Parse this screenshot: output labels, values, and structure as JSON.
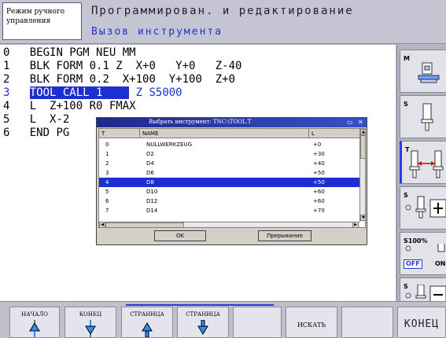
{
  "header": {
    "mode_line1": "Режим ручного",
    "mode_line2": "управления",
    "title": "Программирован. и редактирование",
    "subtitle": "Вызов инструмента"
  },
  "program": {
    "lines": [
      {
        "num": "0",
        "text": "BEGIN PGM NEU MM"
      },
      {
        "num": "1",
        "text": "BLK FORM 0.1 Z  X+0   Y+0   Z-40"
      },
      {
        "num": "2",
        "text": "BLK FORM 0.2  X+100  Y+100  Z+0"
      },
      {
        "num": "3",
        "text_hl": "TOOL CALL 1",
        "text_rest": " Z S5000"
      },
      {
        "num": "4",
        "text": "L  Z+100 R0 FMAX"
      },
      {
        "num": "5",
        "text": "L  X-2"
      },
      {
        "num": "6",
        "text": "END PG"
      }
    ]
  },
  "dialog": {
    "title": "Выбрать инструмент: TNC:\\TOOL.T",
    "columns": [
      "T",
      "NAME",
      "L"
    ],
    "rows": [
      {
        "t": "0",
        "name": "NULLWERKZEUG",
        "l": "+0"
      },
      {
        "t": "1",
        "name": "D2",
        "l": "+30"
      },
      {
        "t": "2",
        "name": "D4",
        "l": "+40"
      },
      {
        "t": "3",
        "name": "D6",
        "l": "+50"
      },
      {
        "t": "4",
        "name": "D8",
        "l": "+50"
      },
      {
        "t": "5",
        "name": "D10",
        "l": "+60"
      },
      {
        "t": "6",
        "name": "D12",
        "l": "+60"
      },
      {
        "t": "7",
        "name": "D14",
        "l": "+70"
      }
    ],
    "selected_index": 4,
    "ok_label": "OK",
    "cancel_label": "Прерывание"
  },
  "right_keys": [
    {
      "label": "M",
      "icon": "machine-table-icon"
    },
    {
      "label": "S",
      "icon": "spindle-icon"
    },
    {
      "label": "T",
      "icon": "tool-length-icon"
    },
    {
      "label": "S",
      "icon": "spindle-plus-icon"
    },
    {
      "label": "S100%",
      "icon": "spindle-override-icon",
      "state": "OFF",
      "state2": "ON"
    },
    {
      "label": "S",
      "icon": "spindle-minus-icon"
    }
  ],
  "softkeys": [
    {
      "label": "НАЧАЛО",
      "icon": "arrow-up-icon"
    },
    {
      "label": "КОНЕЦ",
      "icon": "arrow-down-icon"
    },
    {
      "label": "СТРАНИЦА",
      "icon": "arrow-up-icon"
    },
    {
      "label": "СТРАНИЦА",
      "icon": "arrow-down-icon"
    },
    {
      "label": "",
      "icon": ""
    },
    {
      "label": "ИСКАТЬ",
      "icon": ""
    },
    {
      "label": "",
      "icon": ""
    },
    {
      "label": "КОНЕЦ",
      "icon": ""
    }
  ],
  "colors": {
    "highlight": "#1c2fd0",
    "header_bg": "#c4c4d2",
    "dialog_title": "#1e2a8a"
  }
}
